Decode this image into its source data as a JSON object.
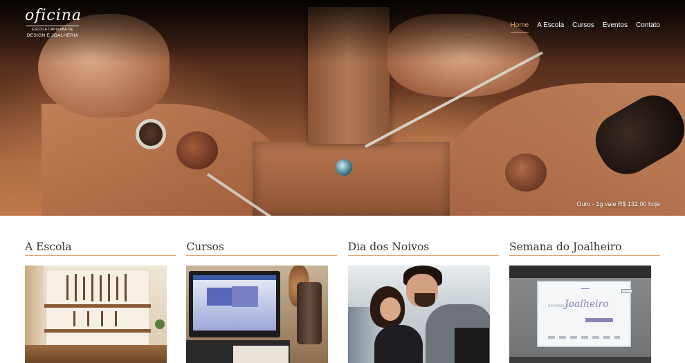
{
  "brand": {
    "logo_word": "oficina",
    "logo_sub1": "ESCOLA CAPIXABA DE",
    "logo_sub2": "DESIGN E JOALHERIA"
  },
  "nav": {
    "items": [
      "Home",
      "A Escola",
      "Cursos",
      "Eventos",
      "Contato"
    ],
    "active": "Home"
  },
  "hero": {
    "gold_price": "Ouro - 1g vale R$ 132,00 hoje"
  },
  "cards": [
    {
      "title": "A Escola"
    },
    {
      "title": "Cursos"
    },
    {
      "title": "Dia dos Noivos"
    },
    {
      "title": "Semana do Joalheiro"
    }
  ],
  "slide": {
    "prefix": "SEMANA DO",
    "title": "Joalheiro"
  },
  "colors": {
    "accent": "#e0a678",
    "title_text": "#333333",
    "nav_text": "#ffffff"
  }
}
